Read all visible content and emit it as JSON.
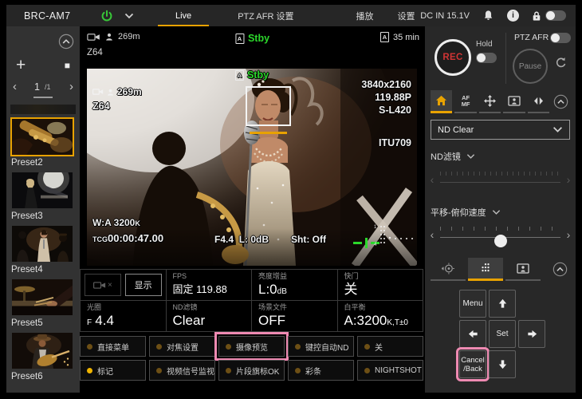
{
  "colors": {
    "accent": "#e8a200",
    "highlight": "#ee8ab2",
    "stby_green": "#2bd82b",
    "power_green": "#38c838",
    "rec_red": "#d03434",
    "led_on": "#f0b400",
    "led_off": "#6d4f15"
  },
  "topbar": {
    "brand": "BRC-AM7",
    "tabs": [
      {
        "label": "Live"
      },
      {
        "label": "PTZ AFR 设置"
      },
      {
        "label": "播放"
      },
      {
        "label": "设置"
      }
    ],
    "power_input": "DC IN 15.1V"
  },
  "sidebar": {
    "page_current": "1",
    "page_total": "/1",
    "presets": [
      {
        "label": "Preset2"
      },
      {
        "label": "Preset3"
      },
      {
        "label": "Preset4"
      },
      {
        "label": "Preset5"
      },
      {
        "label": "Preset6"
      }
    ]
  },
  "statusbar": {
    "distance": "269m",
    "zoom": "Z64",
    "slot": "A",
    "state": "Stby",
    "remaining": "35 min"
  },
  "video_osd": {
    "state": "Stby",
    "slot": "A",
    "distance": "269m",
    "zoom": "Z64",
    "resolution": "3840x2160",
    "frame_rate": "119.88P",
    "color_format": "S-L420",
    "gamma": "ITU709",
    "white_balance": "W:A 3200",
    "white_balance_unit": "K",
    "timecode_label": "TCG",
    "timecode": "00:00:47.00",
    "iris": "F4.4",
    "gain_label": "L:",
    "gain_value": "0dB",
    "shutter": "Sht: Off"
  },
  "info_panel": {
    "display_button": "显示",
    "fps_label": "FPS",
    "fps_value": "固定 119.88",
    "gain_label": "亮度增益",
    "gain_value": "L:0",
    "gain_unit": "dB",
    "shutter_label": "快门",
    "shutter_value": "关",
    "iris_label": "光圈",
    "iris_prefix": "F",
    "iris_value": "4.4",
    "nd_label": "ND滤镜",
    "nd_value": "Clear",
    "scene_label": "场景文件",
    "scene_value": "OFF",
    "wb_label": "白平衡",
    "wb_value": "A:3200",
    "wb_unit": "K,T±0"
  },
  "assign_buttons": [
    {
      "label": "直接菜单"
    },
    {
      "label": "对焦设置"
    },
    {
      "label": "摄像预览"
    },
    {
      "label": "键控自动ND"
    },
    {
      "label": "关"
    },
    {
      "label": "标记"
    },
    {
      "label": "视频信号监视"
    },
    {
      "label": "片段旗标OK"
    },
    {
      "label": "彩条"
    },
    {
      "label": "NIGHTSHOT"
    }
  ],
  "right_panel": {
    "rec": "REC",
    "hold": "Hold",
    "ptz_afr": "PTZ AFR",
    "pause": "Pause",
    "af_line1": "AF",
    "af_line2": "MF",
    "nd_select": "ND Clear",
    "nd_slider_label": "ND滤镜",
    "pt_speed_label": "平移-俯仰速度",
    "menu": "Menu",
    "set": "Set",
    "cancel_line1": "Cancel",
    "cancel_line2": "/Back"
  },
  "icons": {
    "chevron_left": "‹",
    "chevron_right": "›",
    "plus": "+",
    "stop": "■",
    "info": "i"
  }
}
